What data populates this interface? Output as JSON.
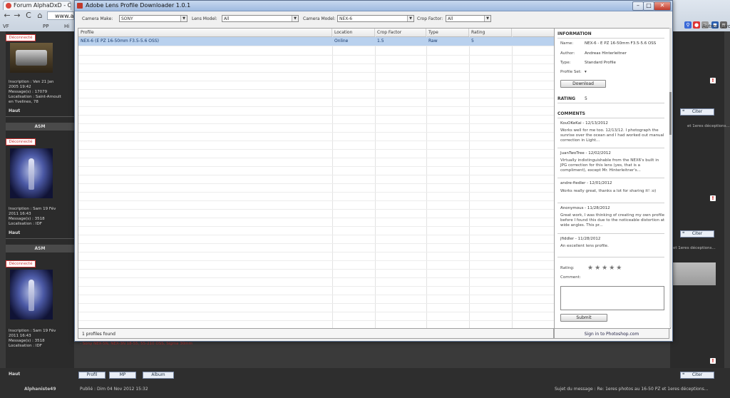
{
  "browser": {
    "tab_title": "Forum AlphaDxD - Consu",
    "url": "www.a",
    "nav": {
      "back": "←",
      "forward": "→",
      "reload": "C",
      "home": "⌂"
    },
    "bookmarks": [
      "VF",
      "PP",
      "Hi"
    ],
    "right_bookmark": "Autres favori"
  },
  "forum": {
    "users": [
      {
        "deconnect": "Déconnecté",
        "info": "Inscription : Ven 21 Jan\n2005 19:42\nMessage(s) : 17079\nLocalisation : Saint-Arnoult\nen Yvelines, 78",
        "haut": "Haut"
      },
      {
        "header": "ASM",
        "deconnect": "Déconnecté",
        "info": "Inscription : Sam 19 Fév\n2011 16:43\nMessage(s) : 3518\nLocalisation : IDF",
        "haut": "Haut"
      },
      {
        "header": "ASM",
        "deconnect": "Déconnecté",
        "info": "Inscription : Sam 19 Fév\n2011 16:43\nMessage(s) : 3518\nLocalisation : IDF",
        "haut": "Haut"
      }
    ],
    "citer": "Citer",
    "right_texts": [
      "et 1eres déceptions...",
      "et 1eres déceptions...",
      "Sujet du message : Re: 1eres photos au 16-50 PZ et 1eres déceptions..."
    ],
    "post_buttons": {
      "profil": "Profil",
      "mp": "MP",
      "album": "Album"
    },
    "footer_user": "Alphaniste49",
    "footer_posted": "Publié : Dim 04 Nov 2012 15:32",
    "red_note": "- Sony NEX-5N, NEX-3N 18-55, 55-210 OSS, Sigma 30mm"
  },
  "dialog": {
    "title": "Adobe Lens Profile Downloader 1.0.1",
    "controls": {
      "minimize": "–",
      "maximize": "□",
      "close": "✕"
    },
    "filters": {
      "camera_make_label": "Camera Make:",
      "camera_make_value": "SONY",
      "lens_model_label": "Lens Model:",
      "lens_model_value": "All",
      "camera_model_label": "Camera Model:",
      "camera_model_value": "NEX-6",
      "crop_factor_label": "Crop Factor:",
      "crop_factor_value": "All"
    },
    "table": {
      "columns": [
        "Profile",
        "Location",
        "Crop Factor",
        "Type",
        "Rating"
      ],
      "rows": [
        [
          "NEX-6 (E PZ 16-50mm F3.5-5.6 OSS)",
          "Online",
          "1.5",
          "Raw",
          "5"
        ]
      ]
    },
    "status": "1 profiles found",
    "info": {
      "title": "INFORMATION",
      "name_label": "Name:",
      "name_value": "NEX-6 - E PZ 16-50mm F3.5-5.6 OSS",
      "author_label": "Author:",
      "author_value": "Andreas Hinterleitner",
      "type_label": "Type:",
      "type_value": "Standard Profile",
      "profile_set_label": "Profile Set:",
      "profile_set_value": "▾",
      "download": "Download"
    },
    "rating": {
      "label": "RATING",
      "value": "5"
    },
    "comments": {
      "title": "COMMENTS",
      "items": [
        {
          "author": "KouOKeKai - 12/13/2012",
          "text": "Works well for me too. 12/13/12. I photograph the sunrise over the ocean and I had worked out manual correction in Light..."
        },
        {
          "author": "JuanTwoTree - 12/02/2012",
          "text": "Virtually indistinguishable from the NEX6's built in JPG correction for this lens (yes, that is a compliment), except Mr. Hinterleitner's..."
        },
        {
          "author": "andre-fiedler - 12/01/2012",
          "text": "Works really great, thanks a lot for sharing it! :o)"
        },
        {
          "author": "Anonymous - 11/28/2012",
          "text": "Great work, I was thinking of creating my own profile before I found this due to the noticeable distortion at wide angles. This pr..."
        },
        {
          "author": "jfiddler - 11/28/2012",
          "text": "An excellent lens profile."
        }
      ]
    },
    "rate_label": "Rating:",
    "stars": "★★★★★",
    "comment_label": "Comment:",
    "submit": "Submit",
    "signin": "Sign in to Photoshop.com"
  }
}
